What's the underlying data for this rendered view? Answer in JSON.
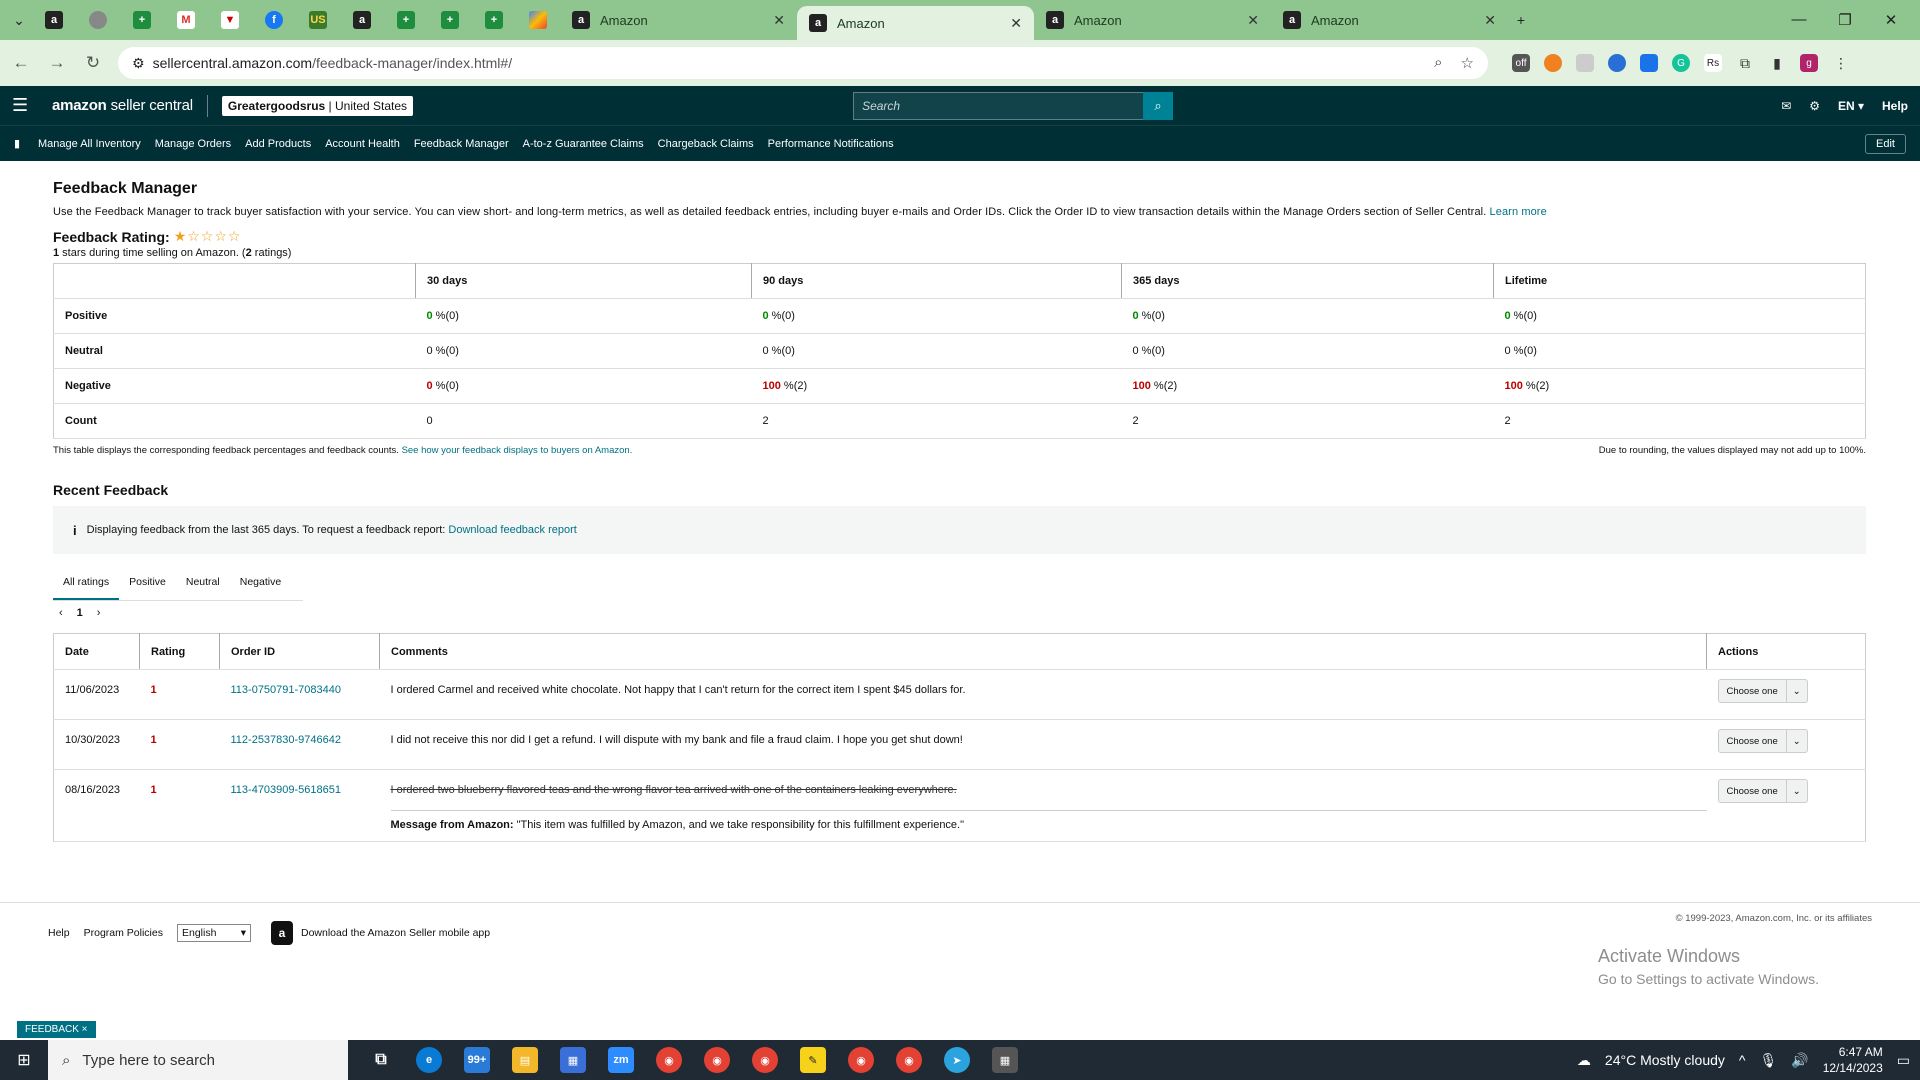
{
  "browser": {
    "tabs": [
      {
        "title": "Amazon",
        "active": false
      },
      {
        "title": "Amazon",
        "active": true
      },
      {
        "title": "Amazon",
        "active": false
      },
      {
        "title": "Amazon",
        "active": false
      }
    ],
    "url_site": "sellercentral.amazon.com",
    "url_path": "/feedback-manager/index.html#/",
    "avatar_letter": "g"
  },
  "header": {
    "logo_bold": "amazon",
    "logo_rest": "seller central",
    "merchant_name": "Greatergoodsrus",
    "merchant_region": "United States",
    "search_placeholder": "Search",
    "lang": "EN",
    "help": "Help"
  },
  "nav": {
    "items": [
      "Manage All Inventory",
      "Manage Orders",
      "Add Products",
      "Account Health",
      "Feedback Manager",
      "A-to-z Guarantee Claims",
      "Chargeback Claims",
      "Performance Notifications"
    ],
    "edit": "Edit"
  },
  "page": {
    "title": "Feedback Manager",
    "intro": "Use the Feedback Manager to track buyer satisfaction with your service. You can view short- and long-term metrics, as well as detailed feedback entries, including buyer e-mails and Order IDs. Click the Order ID to view transaction details within the Manage Orders section of Seller Central.",
    "learn_more": "Learn more",
    "rating_label": "Feedback Rating:",
    "stars_value": 1,
    "rating_sub_num": "1",
    "rating_sub_text": " stars during time selling on Amazon. (",
    "rating_sub_count": "2",
    "rating_sub_end": " ratings)"
  },
  "metrics": {
    "headers": [
      "30 days",
      "90 days",
      "365 days",
      "Lifetime"
    ],
    "rows": [
      {
        "label": "Positive",
        "cells": [
          [
            "0",
            " %(0)"
          ],
          [
            "0",
            " %(0)"
          ],
          [
            "0",
            " %(0)"
          ],
          [
            "0",
            " %(0)"
          ]
        ]
      },
      {
        "label": "Neutral",
        "cells": [
          [
            "0",
            " %(0)"
          ],
          [
            "0",
            " %(0)"
          ],
          [
            "0",
            " %(0)"
          ],
          [
            "0",
            " %(0)"
          ]
        ]
      },
      {
        "label": "Negative",
        "cells": [
          [
            "0",
            " %(0)"
          ],
          [
            "100",
            " %(2)"
          ],
          [
            "100",
            " %(2)"
          ],
          [
            "100",
            " %(2)"
          ]
        ]
      },
      {
        "label": "Count",
        "cells": [
          [
            "0",
            ""
          ],
          [
            "2",
            ""
          ],
          [
            "2",
            ""
          ],
          [
            "2",
            ""
          ]
        ]
      }
    ],
    "note_left": "This table displays the corresponding feedback percentages and feedback counts.",
    "note_link": "See how your feedback displays to buyers on Amazon.",
    "note_right": "Due to rounding, the values displayed may not add up to 100%."
  },
  "recent": {
    "title": "Recent Feedback",
    "info_text": "Displaying feedback from the last 365 days. To request a feedback report:",
    "info_link": "Download feedback report",
    "tabs": [
      "All ratings",
      "Positive",
      "Neutral",
      "Negative"
    ],
    "page": "1",
    "columns": [
      "Date",
      "Rating",
      "Order ID",
      "Comments",
      "Actions"
    ],
    "rows": [
      {
        "date": "11/06/2023",
        "rating": "1",
        "order": "113-0750791-7083440",
        "comment": "I ordered Carmel and received white chocolate. Not happy that I can't return for the correct item I spent $45 dollars for.",
        "action": "Choose one"
      },
      {
        "date": "10/30/2023",
        "rating": "1",
        "order": "112-2537830-9746642",
        "comment": "I did not receive this nor did I get a refund. I will dispute with my bank and file a fraud claim. I hope you get shut down!",
        "action": "Choose one"
      },
      {
        "date": "08/16/2023",
        "rating": "1",
        "order": "113-4703909-5618651",
        "comment": "I ordered two blueberry flavored teas and the wrong flavor tea arrived with one of the containers leaking everywhere.",
        "action": "Choose one",
        "msg_label": "Message from Amazon:",
        "msg_text": " \"This item was fulfilled by Amazon, and we take responsibility for this fulfillment experience.\""
      }
    ]
  },
  "footer": {
    "help": "Help",
    "policies": "Program Policies",
    "language": "English",
    "app": "Download the Amazon Seller mobile app",
    "copyright": "© 1999-2023, Amazon.com, Inc. or its affiliates",
    "feedback_tag": "FEEDBACK ×"
  },
  "windows": {
    "activate_title": "Activate Windows",
    "activate_sub": "Go to Settings to activate Windows.",
    "search": "Type here to search",
    "weather": "24°C  Mostly cloudy",
    "time": "6:47 AM",
    "date": "12/14/2023"
  }
}
